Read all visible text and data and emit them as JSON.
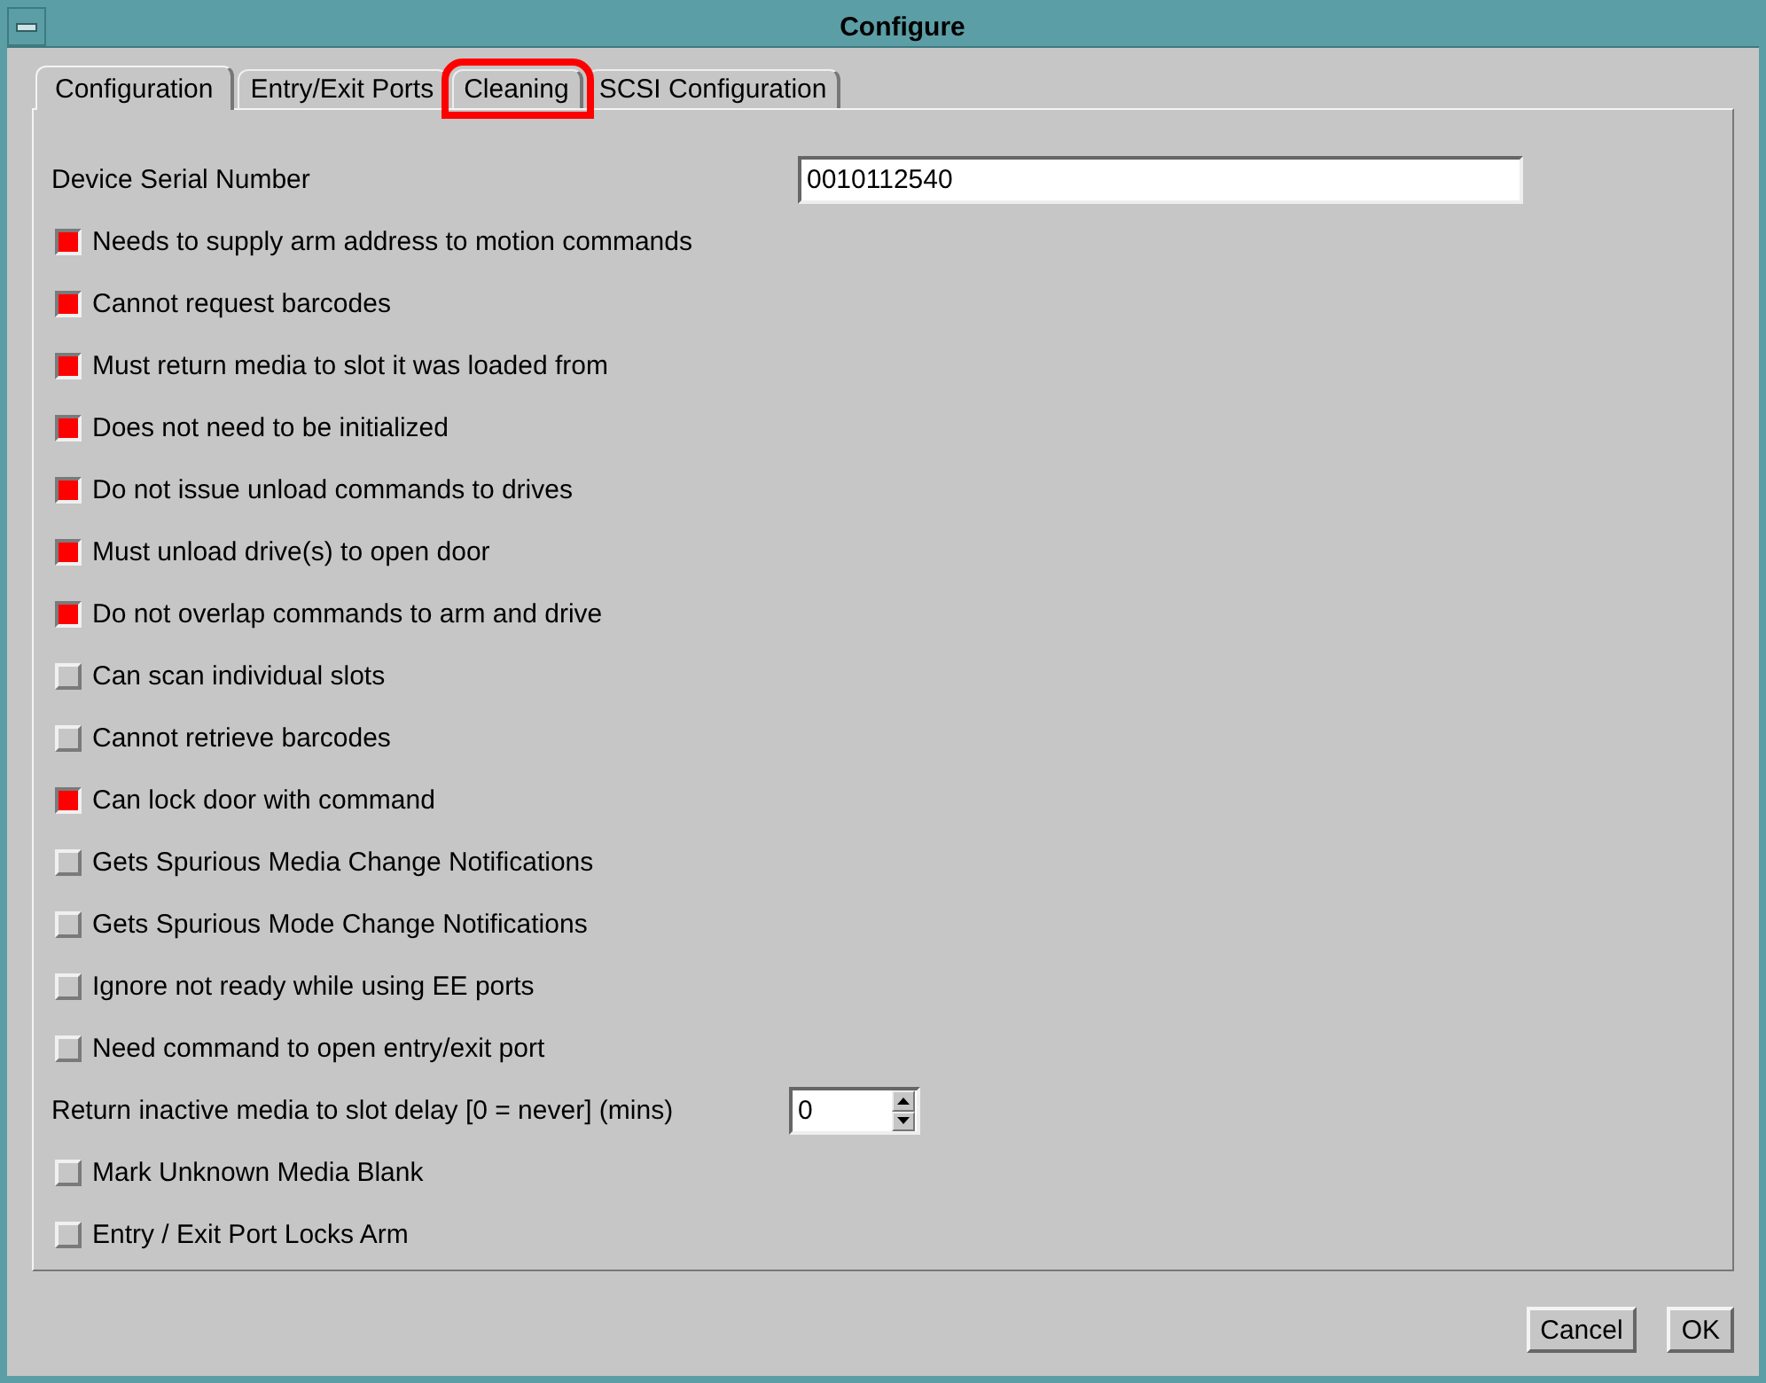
{
  "window": {
    "title": "Configure"
  },
  "tabs": [
    {
      "label": "Configuration",
      "selected": true,
      "highlighted": false
    },
    {
      "label": "Entry/Exit Ports",
      "selected": false,
      "highlighted": false
    },
    {
      "label": "Cleaning",
      "selected": false,
      "highlighted": true
    },
    {
      "label": "SCSI Configuration",
      "selected": false,
      "highlighted": false
    }
  ],
  "rows": [
    {
      "kind": "field",
      "label": "Device Serial Number",
      "value": "0010112540"
    },
    {
      "kind": "checkbox",
      "label": "Needs to supply arm address to motion commands",
      "checked": true
    },
    {
      "kind": "checkbox",
      "label": "Cannot request barcodes",
      "checked": true
    },
    {
      "kind": "checkbox",
      "label": "Must return media to slot it was loaded from",
      "checked": true
    },
    {
      "kind": "checkbox",
      "label": "Does not need to be initialized",
      "checked": true
    },
    {
      "kind": "checkbox",
      "label": "Do not issue unload commands to drives",
      "checked": true
    },
    {
      "kind": "checkbox",
      "label": "Must unload drive(s) to open door",
      "checked": true
    },
    {
      "kind": "checkbox",
      "label": "Do not overlap commands to arm and drive",
      "checked": true
    },
    {
      "kind": "checkbox",
      "label": "Can scan individual slots",
      "checked": false
    },
    {
      "kind": "checkbox",
      "label": "Cannot retrieve barcodes",
      "checked": false
    },
    {
      "kind": "checkbox",
      "label": "Can lock door with command",
      "checked": true
    },
    {
      "kind": "checkbox",
      "label": "Gets Spurious Media Change Notifications",
      "checked": false
    },
    {
      "kind": "checkbox",
      "label": "Gets Spurious Mode Change Notifications",
      "checked": false
    },
    {
      "kind": "checkbox",
      "label": "Ignore not ready while using EE ports",
      "checked": false
    },
    {
      "kind": "checkbox",
      "label": "Need command to open entry/exit port",
      "checked": false
    },
    {
      "kind": "spinner",
      "label": "Return inactive media to slot delay [0 = never] (mins)",
      "value": "0"
    },
    {
      "kind": "checkbox",
      "label": "Mark Unknown Media Blank",
      "checked": false
    },
    {
      "kind": "checkbox",
      "label": "Entry / Exit Port Locks Arm",
      "checked": false
    }
  ],
  "buttons": [
    "Cancel",
    "OK"
  ]
}
